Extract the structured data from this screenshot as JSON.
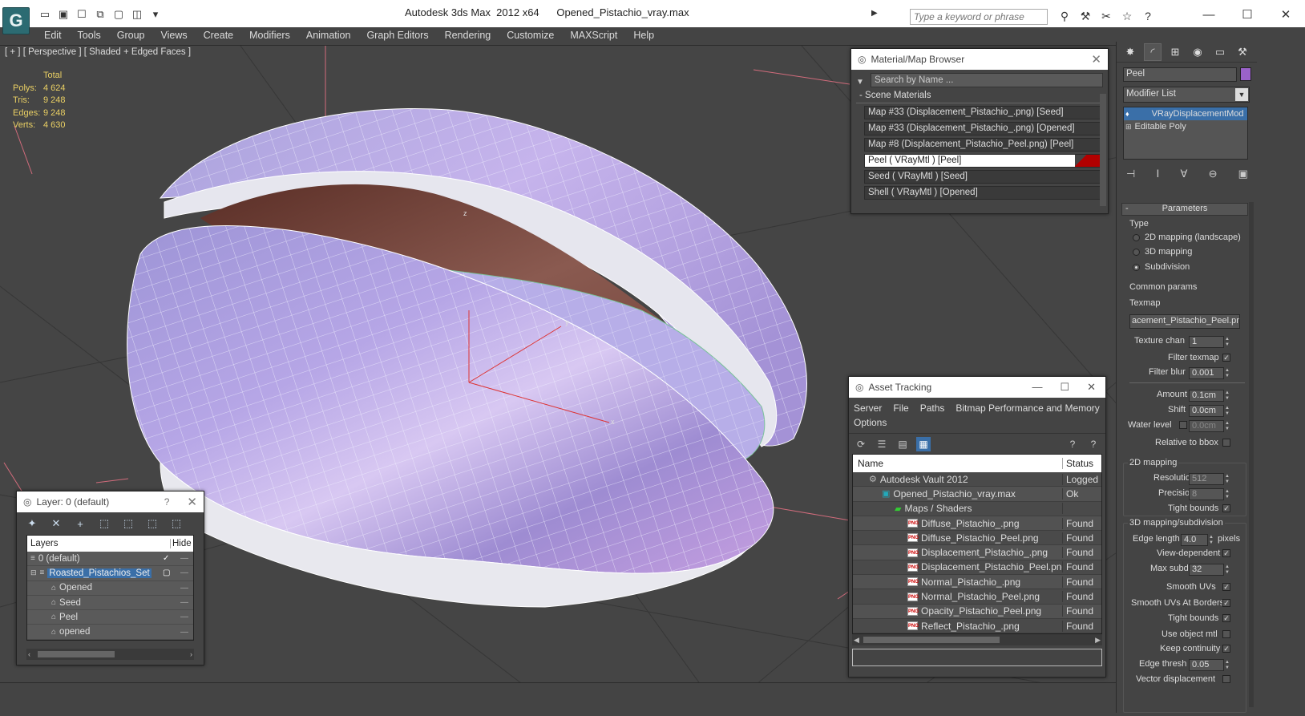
{
  "window": {
    "title": "Autodesk 3ds Max  2012 x64      Opened_Pistachio_vray.max",
    "search_placeholder": "Type a keyword or phrase",
    "logo": "3ds-max-logo"
  },
  "menu": [
    "Edit",
    "Tools",
    "Group",
    "Views",
    "Create",
    "Modifiers",
    "Animation",
    "Graph Editors",
    "Rendering",
    "Customize",
    "MAXScript",
    "Help"
  ],
  "viewport": {
    "label": "[ + ] [ Perspective ] [ Shaded + Edged Faces ]",
    "stats": {
      "header": "Total",
      "rows": [
        {
          "k": "Polys:",
          "v": "4 624"
        },
        {
          "k": "Tris:",
          "v": "9 248"
        },
        {
          "k": "Edges:",
          "v": "9 248"
        },
        {
          "k": "Verts:",
          "v": "4 630"
        }
      ]
    },
    "axis_labels": {
      "x": "x",
      "y": "y",
      "z": "z"
    }
  },
  "material_browser": {
    "title": "Material/Map Browser",
    "search": "Search by Name ...",
    "section": "- Scene Materials",
    "items": [
      "Map #33 (Displacement_Pistachio_.png)  [Seed]",
      "Map #33 (Displacement_Pistachio_.png)  [Opened]",
      "Map #8 (Displacement_Pistachio_Peel.png)  [Peel]",
      "Peel  ( VRayMtl )  [Peel]",
      "Seed  ( VRayMtl )  [Seed]",
      "Shell  ( VRayMtl )  [Opened]"
    ]
  },
  "asset_tracking": {
    "title": "Asset Tracking",
    "menus": [
      "Server",
      "File",
      "Paths",
      "Bitmap Performance and Memory",
      "Options"
    ],
    "columns": {
      "name": "Name",
      "status": "Status"
    },
    "rows": [
      {
        "name": "Autodesk Vault 2012",
        "status": "Logged",
        "indent": 1,
        "icon": "vault-icon"
      },
      {
        "name": "Opened_Pistachio_vray.max",
        "status": "Ok",
        "indent": 2,
        "icon": "max-file-icon"
      },
      {
        "name": "Maps / Shaders",
        "status": "",
        "indent": 3,
        "icon": "maps-icon"
      },
      {
        "name": "Diffuse_Pistachio_.png",
        "status": "Found",
        "indent": 4,
        "icon": "png-icon"
      },
      {
        "name": "Diffuse_Pistachio_Peel.png",
        "status": "Found",
        "indent": 4,
        "icon": "png-icon"
      },
      {
        "name": "Displacement_Pistachio_.png",
        "status": "Found",
        "indent": 4,
        "icon": "png-icon"
      },
      {
        "name": "Displacement_Pistachio_Peel.png",
        "status": "Found",
        "indent": 4,
        "icon": "png-icon"
      },
      {
        "name": "Normal_Pistachio_.png",
        "status": "Found",
        "indent": 4,
        "icon": "png-icon"
      },
      {
        "name": "Normal_Pistachio_Peel.png",
        "status": "Found",
        "indent": 4,
        "icon": "png-icon"
      },
      {
        "name": "Opacity_Pistachio_Peel.png",
        "status": "Found",
        "indent": 4,
        "icon": "png-icon"
      },
      {
        "name": "Reflect_Pistachio_.png",
        "status": "Found",
        "indent": 4,
        "icon": "png-icon"
      }
    ]
  },
  "layer_panel": {
    "title": "Layer: 0 (default)",
    "help": "?",
    "columns": {
      "layers": "Layers",
      "hide": "Hide"
    },
    "rows": [
      {
        "name": "0 (default)",
        "level": 0
      },
      {
        "name": "Roasted_Pistachios_Set",
        "level": 0
      },
      {
        "name": "Opened",
        "level": 1
      },
      {
        "name": "Seed",
        "level": 1
      },
      {
        "name": "Peel",
        "level": 1
      },
      {
        "name": "opened",
        "level": 1
      }
    ]
  },
  "command_panel": {
    "object_name": "Peel",
    "object_color": "#9a62c9",
    "modifier_list": "Modifier List",
    "stack": [
      "VRayDisplacementMod",
      "Editable Poly"
    ],
    "rollout": "Parameters",
    "type_label": "Type",
    "type_options": [
      "2D mapping (landscape)",
      "3D mapping",
      "Subdivision"
    ],
    "common_params": "Common params",
    "texmap_label": "Texmap",
    "texmap_value": "acement_Pistachio_Peel.png)",
    "texture_chan_label": "Texture chan",
    "texture_chan": "1",
    "filter_texmap": "Filter texmap",
    "filter_blur_label": "Filter blur",
    "filter_blur": "0.001",
    "amount_label": "Amount",
    "amount": "0.1cm",
    "shift_label": "Shift",
    "shift": "0.0cm",
    "water_level_label": "Water level",
    "water_level": "0.0cm",
    "relative_bbox": "Relative to bbox",
    "mapping2d": "2D mapping",
    "resolution_label": "Resolution",
    "resolution": "512",
    "precision_label": "Precision",
    "precision": "8",
    "tight_bounds": "Tight bounds",
    "mapping3d": "3D mapping/subdivision",
    "edge_length_label": "Edge length",
    "edge_length": "4.0",
    "pixels": "pixels",
    "view_dependent": "View-dependent",
    "max_subdivs_label": "Max subdivs",
    "max_subdivs": "32",
    "smooth_uvs": "Smooth UVs",
    "smooth_uvs_borders": "Smooth UVs At Borders",
    "tight_bounds2": "Tight bounds",
    "use_object_mtl": "Use object mtl",
    "keep_continuity": "Keep continuity",
    "edge_thresh_label": "Edge thresh",
    "edge_thresh": "0.05",
    "vector_displacement": "Vector displacement"
  },
  "colors": {
    "accent": "#3a6fa8",
    "stats": "#ead064",
    "background": "#444444",
    "wireframe": "#ffffff"
  }
}
